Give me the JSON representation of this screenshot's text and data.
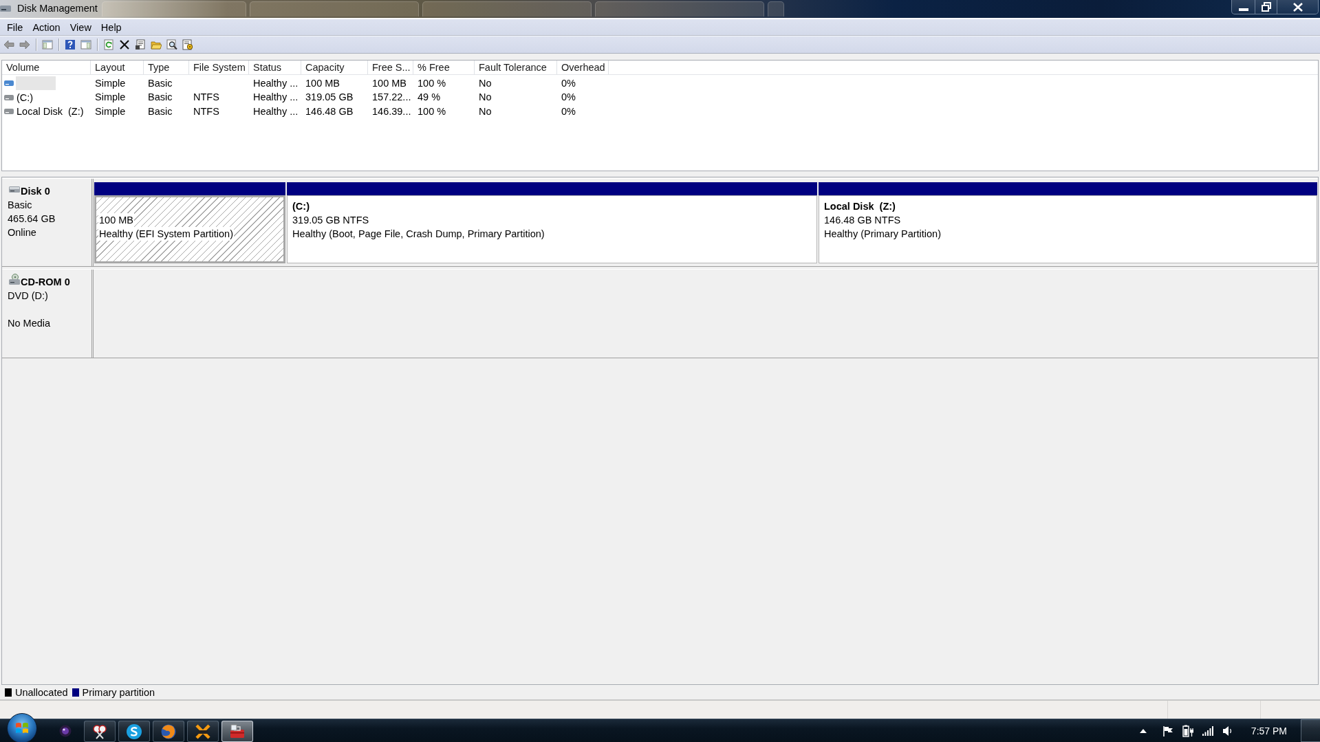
{
  "window": {
    "title": "Disk Management"
  },
  "menu": [
    "File",
    "Action",
    "View",
    "Help"
  ],
  "volume_list": {
    "columns": [
      "Volume",
      "Layout",
      "Type",
      "File System",
      "Status",
      "Capacity",
      "Free S...",
      "% Free",
      "Fault Tolerance",
      "Overhead"
    ],
    "rows": [
      {
        "selected": true,
        "color": "#4a88d0",
        "layout": "Simple",
        "type": "Basic",
        "status": "Healthy ...",
        "capacity": "100 MB",
        "free_space": "100 MB",
        "percent_free": "100 %",
        "fault_tolerance": "No",
        "overhead": "0%"
      },
      {
        "selected": false,
        "color": "#8e9296",
        "volume": "(C:)",
        "layout": "Simple",
        "type": "Basic",
        "file_system": "NTFS",
        "status": "Healthy ...",
        "capacity": "319.05 GB",
        "free_space": "157.22...",
        "percent_free": "49 %",
        "fault_tolerance": "No",
        "overhead": "0%"
      },
      {
        "selected": false,
        "color": "#8e9296",
        "volume": "Local Disk  (Z:)",
        "layout": "Simple",
        "type": "Basic",
        "file_system": "NTFS",
        "status": "Healthy ...",
        "capacity": "146.48 GB",
        "free_space": "146.39...",
        "percent_free": "100 %",
        "fault_tolerance": "No",
        "overhead": "0%"
      }
    ]
  },
  "disks": [
    {
      "kind": "disk",
      "name": "Disk 0",
      "type": "Basic",
      "size": "465.64 GB",
      "status": "Online",
      "partitions": [
        {
          "selected": true,
          "size": "100 MB",
          "status": "Healthy (EFI System Partition)"
        },
        {
          "selected": false,
          "name": "(C:)",
          "size": "319.05 GB NTFS",
          "status": "Healthy (Boot, Page File, Crash Dump, Primary Partition)"
        },
        {
          "selected": false,
          "name": "Local Disk  (Z:)",
          "size": "146.48 GB NTFS",
          "status": "Healthy (Primary Partition)"
        }
      ]
    },
    {
      "kind": "cdrom",
      "name": "CD-ROM 0",
      "drive": "DVD (D:)",
      "status": "No Media"
    }
  ],
  "legend": [
    {
      "label": "Unallocated",
      "color": "#000000"
    },
    {
      "label": "Primary partition",
      "color": "#000080"
    }
  ],
  "taskbar": {
    "apps": [
      {
        "selected": false
      },
      {
        "selected": false
      },
      {
        "selected": false
      },
      {
        "selected": false
      },
      {
        "selected": true
      }
    ],
    "clock": "7:57 PM"
  }
}
